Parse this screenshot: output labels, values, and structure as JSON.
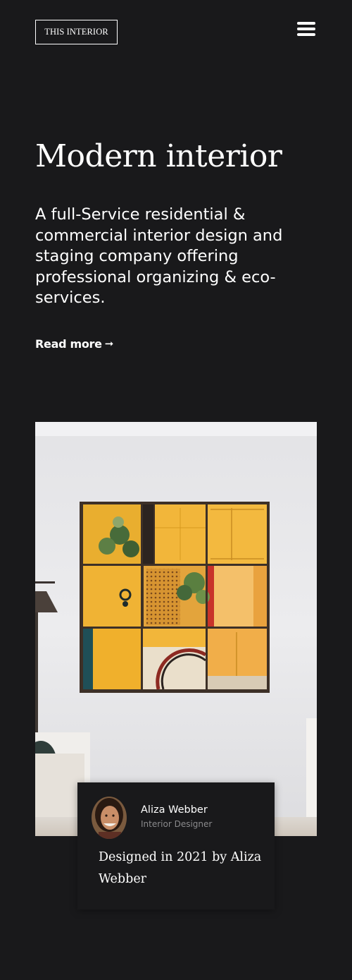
{
  "header": {
    "logo_text": "THIS INTERIOR",
    "menu_icon": "hamburger-icon"
  },
  "hero": {
    "title": "Modern interior",
    "description": "A full-Service residential & commercial interior design and staging company offering professional organizing & eco-services.",
    "read_more_label": "Read more",
    "read_more_icon": "arrow-right-icon",
    "read_more_arrow": "➞"
  },
  "feature": {
    "author_name": "Aliza Webber",
    "author_role": "Interior Designer",
    "caption": "Designed in 2021 by Aliza Webber"
  },
  "colors": {
    "background": "#19191b",
    "text": "#ffffff",
    "muted": "#8a8a8c",
    "accent_yellow": "#f2b93b"
  }
}
